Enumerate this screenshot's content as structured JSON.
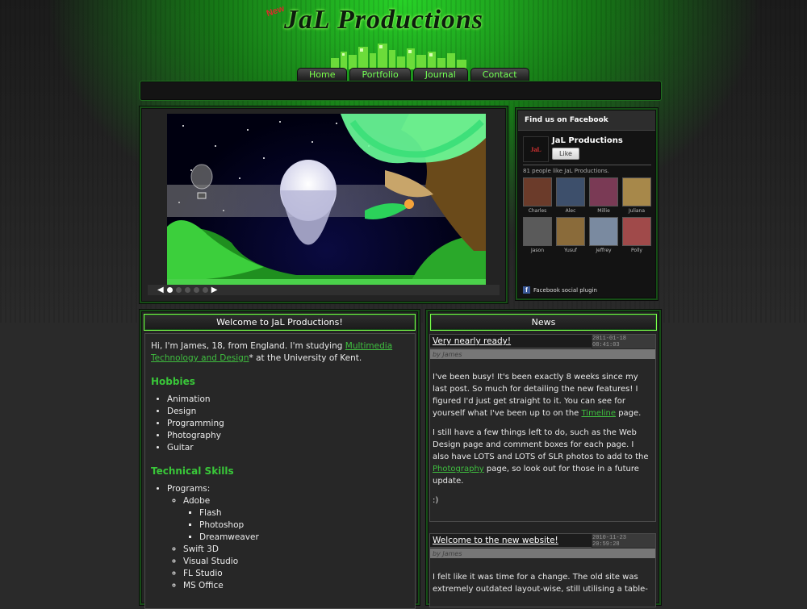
{
  "header": {
    "logo_new": "New",
    "logo_text": "JaL Productions"
  },
  "nav": {
    "tabs": [
      {
        "label": "Home"
      },
      {
        "label": "Portfolio"
      },
      {
        "label": "Journal"
      },
      {
        "label": "Contact"
      }
    ],
    "active": "Home"
  },
  "slider": {
    "prev_icon": "◀",
    "next_icon": "▶",
    "slides": 5,
    "current": 1
  },
  "facebook": {
    "header": "Find us on Facebook",
    "page_name": "JaL Productions",
    "page_logo_text": "JaL",
    "like_label": "Like",
    "count_text": "81 people like JaL Productions.",
    "fans": [
      {
        "name": "Charles",
        "color": "#6b3b2a"
      },
      {
        "name": "Alec",
        "color": "#3d4f6b"
      },
      {
        "name": "Millie",
        "color": "#7a3a55"
      },
      {
        "name": "Juliana",
        "color": "#a7884a"
      },
      {
        "name": "Jason",
        "color": "#5a5a5a"
      },
      {
        "name": "Yusuf",
        "color": "#8a6b3a"
      },
      {
        "name": "Jeffrey",
        "color": "#7a8aa0"
      },
      {
        "name": "Polly",
        "color": "#a04a4a"
      }
    ],
    "footer": "Facebook social plugin"
  },
  "welcome": {
    "title": "Welcome to JaL Productions!",
    "intro_before": "Hi, I'm James, 18, from England. I'm studying ",
    "intro_link": "Multimedia Technology and Design",
    "intro_after": "* at the University of Kent.",
    "hobbies_heading": "Hobbies",
    "hobbies": [
      "Animation",
      "Design",
      "Programming",
      "Photography",
      "Guitar"
    ],
    "skills_heading": "Technical Skills",
    "skills_programs_label": "Programs:",
    "adobe_label": "Adobe",
    "adobe_items": [
      "Flash",
      "Photoshop",
      "Dreamweaver"
    ],
    "other_programs": [
      "Swift 3D",
      "Visual Studio",
      "FL Studio",
      "MS Office"
    ]
  },
  "news": {
    "title": "News",
    "posts": [
      {
        "title": "Very nearly ready!",
        "date": "2011-01-18 08:41:03",
        "by": "by James",
        "p1_before": "I've been busy! It's been exactly 8 weeks since my last post. So much for detailing the new features! I figured I'd just get straight to it. You can see for yourself what I've been up to on the ",
        "p1_link": "Timeline",
        "p1_after": " page.",
        "p2_before": "I still have a few things left to do, such as the Web Design page and comment boxes for each page. I also have LOTS and LOTS of SLR photos to add to the ",
        "p2_link": "Photography",
        "p2_after": " page, so look out for those in a future update.",
        "p3": ":)"
      },
      {
        "title": "Welcome to the new website!",
        "date": "2010-11-23 20:59:28",
        "by": "by James",
        "p1": "I felt like it was time for a change. The old site was extremely outdated layout-wise, still utilising a table-"
      }
    ]
  },
  "colors": {
    "accent": "#7bff4a",
    "link": "#3fbf3f",
    "heading": "#39c739"
  }
}
